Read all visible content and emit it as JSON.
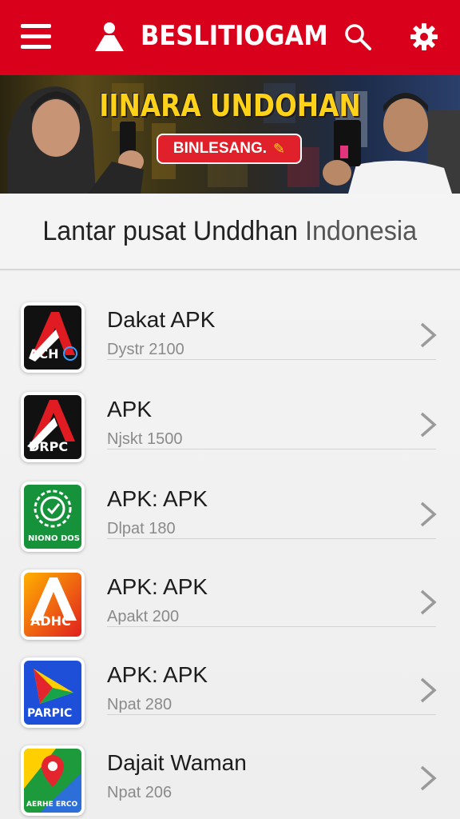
{
  "header": {
    "title": "BESLITIOGAM",
    "icons": [
      "menu-icon",
      "person-icon",
      "search-icon",
      "settings-icon"
    ],
    "accent_color": "#d9001b"
  },
  "banner": {
    "headline": "IINARA UNDOHAN",
    "cta_label": "BINLESANG.",
    "headline_color": "#ffd21a",
    "cta_color": "#e0202a"
  },
  "page": {
    "title_main": "Lantar pusat Unddhan ",
    "title_muted": "Indonesia"
  },
  "apps": [
    {
      "name": "Dakat APK",
      "meta": "Dystr 2100",
      "icon_text": "ACH",
      "icon": "red-black-a-logo"
    },
    {
      "name": "APK",
      "meta": "Njskt 1500",
      "icon_text": "DRPC",
      "icon": "red-black-a-logo"
    },
    {
      "name": "APK: APK",
      "meta": "Dlpat 180",
      "icon_text": "NIONO DOS",
      "icon": "green-badge-logo"
    },
    {
      "name": "APK: APK",
      "meta": "Apakt 200",
      "icon_text": "ADHC",
      "icon": "orange-a-logo"
    },
    {
      "name": "APK: APK",
      "meta": "Npat 280",
      "icon_text": "PARPIC",
      "icon": "colorful-triangle-logo"
    },
    {
      "name": "Dajait Waman",
      "meta": "Npat 206",
      "icon_text": "AERHE ERCO",
      "icon": "map-pin-logo"
    }
  ]
}
